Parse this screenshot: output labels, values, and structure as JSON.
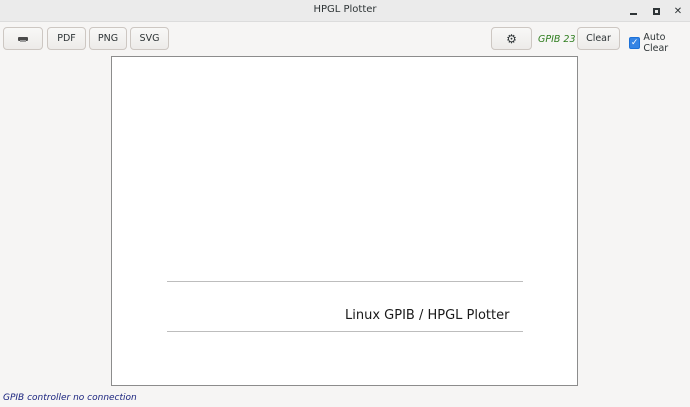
{
  "window": {
    "title": "HPGL Plotter",
    "controls": {
      "minimize_icon": "minimize-icon",
      "maximize_icon": "maximize-icon",
      "close_icon": "close-icon",
      "close_glyph": "✕"
    }
  },
  "toolbar": {
    "print_icon": "printer-icon",
    "pdf_label": "PDF",
    "png_label": "PNG",
    "svg_label": "SVG",
    "settings_icon": "gear-icon",
    "settings_glyph": "⚙",
    "gpib_address": "GPIB 23",
    "clear_label": "Clear",
    "auto_clear": {
      "label": "Auto Clear",
      "checked": true,
      "check_glyph": "✓"
    }
  },
  "canvas": {
    "plot_text": "Linux GPIB / HPGL Plotter"
  },
  "status": {
    "text": "GPIB controller no connection"
  },
  "colors": {
    "gpib_label": "#2e7d1e",
    "status_text": "#1a237e",
    "checkbox_accent": "#3584e4"
  }
}
